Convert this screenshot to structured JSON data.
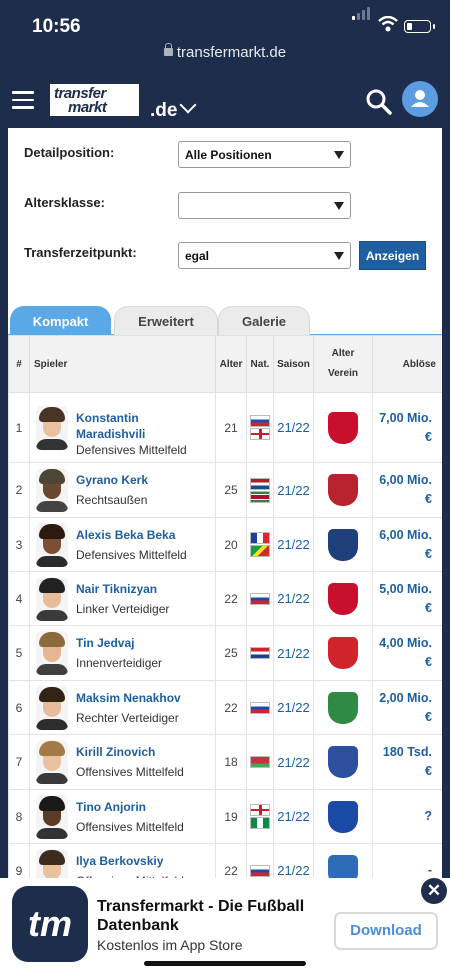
{
  "status": {
    "time": "10:56"
  },
  "browser": {
    "url": "transfermarkt.de"
  },
  "nav": {
    "logo_line1": "transfer",
    "logo_line2": "markt",
    "tld": ".de"
  },
  "filters": {
    "detail_label": "Detailposition:",
    "detail_value": "Alle Positionen",
    "age_label": "Altersklasse:",
    "age_value": "",
    "time_label": "Transferzeitpunkt:",
    "time_value": "egal",
    "submit": "Anzeigen"
  },
  "tabs": [
    "Kompakt",
    "Erweitert",
    "Galerie"
  ],
  "table": {
    "headers": {
      "num": "#",
      "player": "Spieler",
      "age": "Alter",
      "nat": "Nat.",
      "season": "Saison",
      "old_club": "Alter Verein",
      "fee": "Ablöse"
    },
    "rows": [
      {
        "num": "1",
        "name": "Konstantin Maradishvili",
        "position": "Defensives Mittelfeld",
        "age": "21",
        "flags": [
          "ru",
          "en"
        ],
        "season": "21/22",
        "fee": "7,00 Mio. €"
      },
      {
        "num": "2",
        "name": "Gyrano Kerk",
        "position": "Rechtsaußen",
        "age": "25",
        "flags": [
          "nl",
          "sr"
        ],
        "season": "21/22",
        "fee": "6,00 Mio. €"
      },
      {
        "num": "3",
        "name": "Alexis Beka Beka",
        "position": "Defensives Mittelfeld",
        "age": "20",
        "flags": [
          "fr",
          "cg"
        ],
        "season": "21/22",
        "fee": "6,00 Mio. €"
      },
      {
        "num": "4",
        "name": "Nair Tiknizyan",
        "position": "Linker Verteidiger",
        "age": "22",
        "flags": [
          "ru"
        ],
        "season": "21/22",
        "fee": "5,00 Mio. €"
      },
      {
        "num": "5",
        "name": "Tin Jedvaj",
        "position": "Innenverteidiger",
        "age": "25",
        "flags": [
          "hr"
        ],
        "season": "21/22",
        "fee": "4,00 Mio. €"
      },
      {
        "num": "6",
        "name": "Maksim Nenakhov",
        "position": "Rechter Verteidiger",
        "age": "22",
        "flags": [
          "ru"
        ],
        "season": "21/22",
        "fee": "2,00 Mio. €"
      },
      {
        "num": "7",
        "name": "Kirill Zinovich",
        "position": "Offensives Mittelfeld",
        "age": "18",
        "flags": [
          "by"
        ],
        "season": "21/22",
        "fee": "180 Tsd. €"
      },
      {
        "num": "8",
        "name": "Tino Anjorin",
        "position": "Offensives Mittelfeld",
        "age": "19",
        "flags": [
          "en",
          "ng"
        ],
        "season": "21/22",
        "fee": "?"
      },
      {
        "num": "9",
        "name": "Ilya Berkovskiy",
        "position": "Offensives Mittelfeld",
        "age": "22",
        "flags": [
          "ru"
        ],
        "season": "21/22",
        "fee": "-"
      }
    ]
  },
  "banner": {
    "app_icon_text": "tm",
    "title": "Transfermarkt - Die Fußball Datenbank",
    "subtitle": "Kostenlos im App Store",
    "download": "Download"
  },
  "colors": {
    "navy": "#1d2d4b",
    "accent": "#5aa9e6",
    "link": "#1d5fa1"
  },
  "icons": [
    "menu-icon",
    "search-icon",
    "user-icon",
    "chevron-down-icon",
    "lock-icon",
    "close-icon"
  ]
}
